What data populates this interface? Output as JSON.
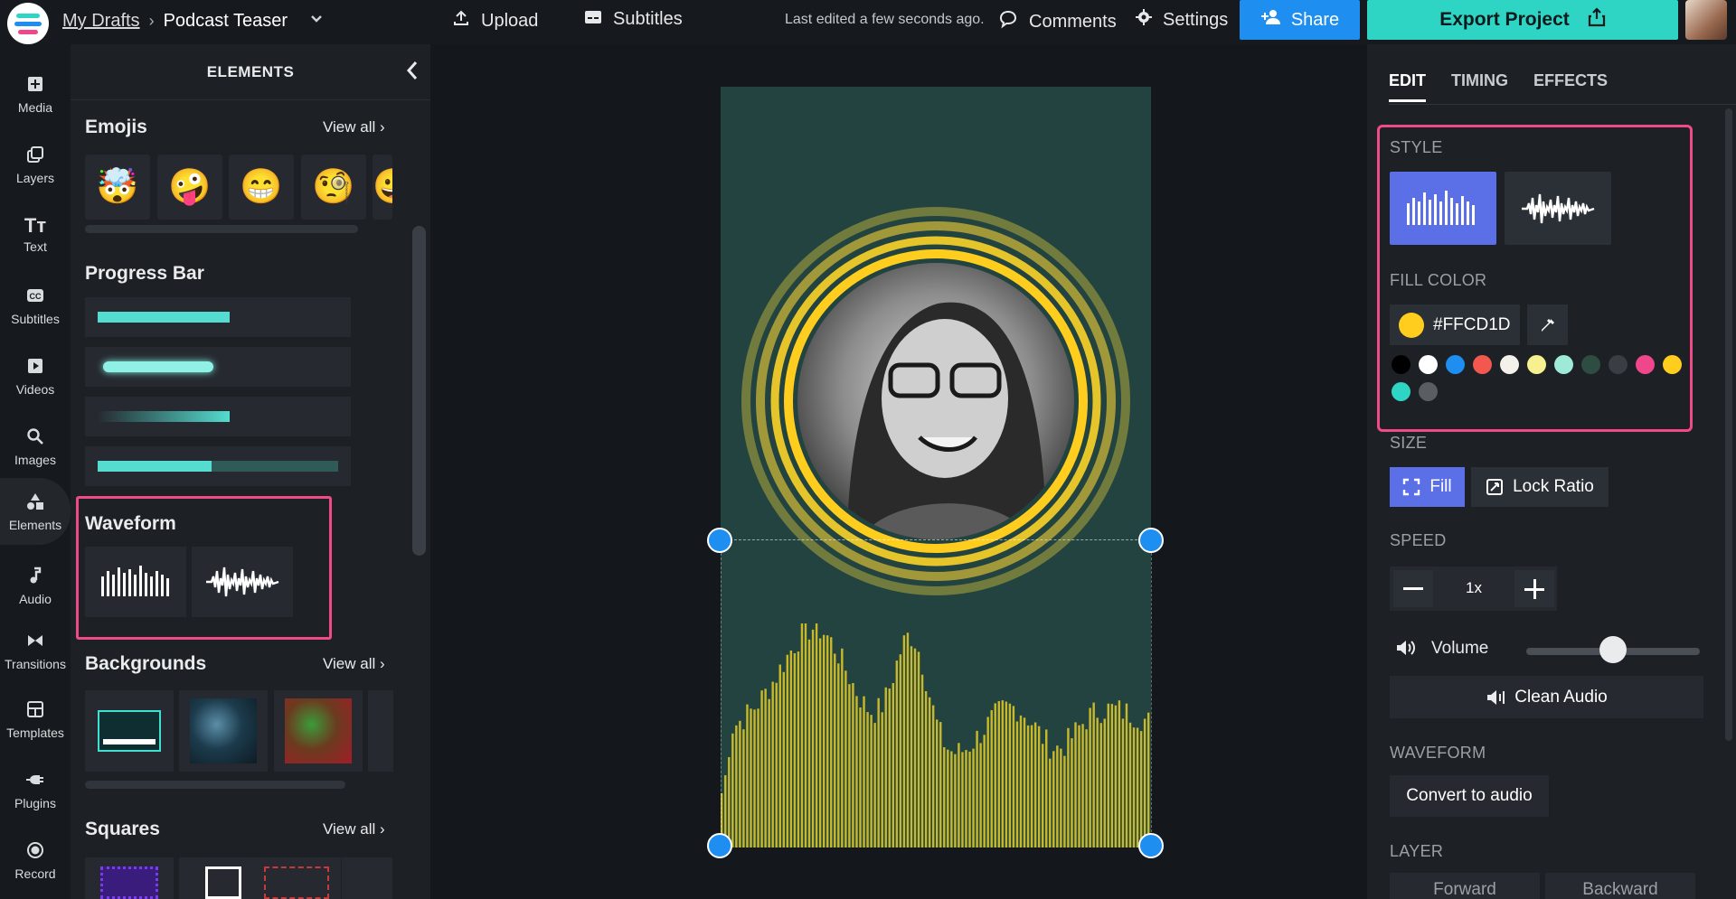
{
  "topbar": {
    "breadcrumb_root": "My Drafts",
    "breadcrumb_sep": "›",
    "project_title": "Podcast Teaser",
    "upload_label": "Upload",
    "subtitles_label": "Subtitles",
    "last_edited": "Last edited a few seconds ago.",
    "comments_label": "Comments",
    "settings_label": "Settings",
    "share_label": "Share",
    "export_label": "Export Project"
  },
  "rail": {
    "items": [
      {
        "label": "Media",
        "icon": "media-icon"
      },
      {
        "label": "Layers",
        "icon": "layers-icon"
      },
      {
        "label": "Text",
        "icon": "text-icon"
      },
      {
        "label": "Subtitles",
        "icon": "subtitles-icon"
      },
      {
        "label": "Videos",
        "icon": "videos-icon"
      },
      {
        "label": "Images",
        "icon": "images-icon"
      },
      {
        "label": "Elements",
        "icon": "elements-icon"
      },
      {
        "label": "Audio",
        "icon": "audio-icon"
      },
      {
        "label": "Transitions",
        "icon": "transitions-icon"
      },
      {
        "label": "Templates",
        "icon": "templates-icon"
      },
      {
        "label": "Plugins",
        "icon": "plugins-icon"
      },
      {
        "label": "Record",
        "icon": "record-icon"
      }
    ],
    "active": "Elements"
  },
  "elements_panel": {
    "title": "ELEMENTS",
    "view_all": "View all ›",
    "sections": {
      "emojis": "Emojis",
      "progress_bar": "Progress Bar",
      "waveform": "Waveform",
      "backgrounds": "Backgrounds",
      "squares": "Squares"
    },
    "emojis": [
      "🤯",
      "🤪",
      "😁",
      "🧐",
      "😀"
    ],
    "progress_bars": [
      {
        "style": "solid",
        "progress": 0.5
      },
      {
        "style": "glow",
        "progress": 0.45
      },
      {
        "style": "gradient",
        "progress": 0.5
      },
      {
        "style": "track",
        "progress": 0.47
      }
    ]
  },
  "right_panel": {
    "tabs": [
      "EDIT",
      "TIMING",
      "EFFECTS"
    ],
    "active_tab": "EDIT",
    "style_label": "STYLE",
    "fill_color_label": "FILL COLOR",
    "fill_color_value": "#FFCD1D",
    "swatches": [
      "#000000",
      "#ffffff",
      "#1f8ef1",
      "#f2584e",
      "#f4f1ea",
      "#f6f08e",
      "#9ee9d8",
      "#2e4c42",
      "#3a3d44",
      "#f0468c",
      "#ffcd1d",
      "#2fd5c4",
      "#5a5d62"
    ],
    "size_label": "SIZE",
    "fill_button": "Fill",
    "lock_ratio_button": "Lock Ratio",
    "speed_label": "SPEED",
    "speed_value": "1x",
    "volume_label": "Volume",
    "volume_level": 0.5,
    "clean_audio": "Clean Audio",
    "waveform_label": "WAVEFORM",
    "convert_to_audio": "Convert to audio",
    "layer_label": "LAYER",
    "forward_label": "Forward",
    "backward_label": "Backward"
  },
  "colors": {
    "accent_blue": "#1f8ef1",
    "export_teal": "#2fd5c4",
    "highlight_pink": "#f04a8a",
    "waveform_yellow": "#ffcd1d",
    "artboard_bg": "#22433f"
  }
}
